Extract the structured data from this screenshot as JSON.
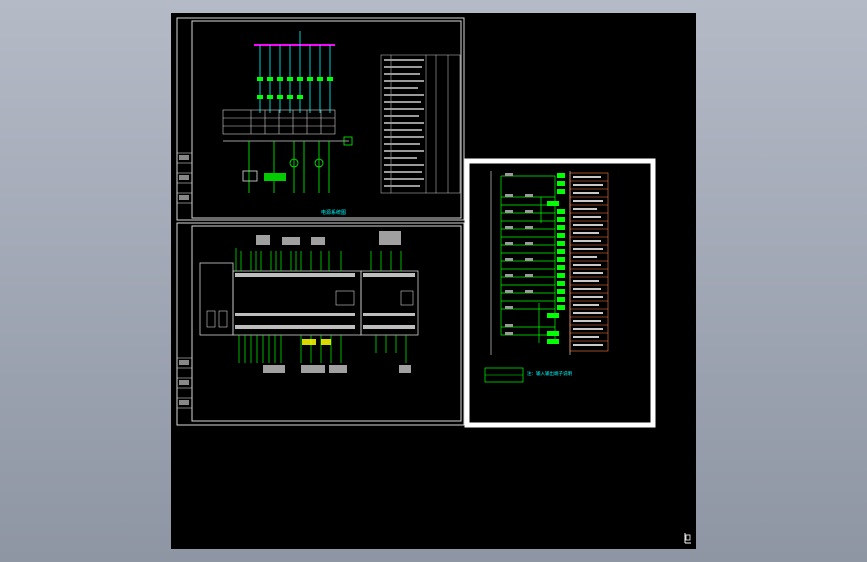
{
  "viewport": {
    "background_top": "#b4bac6",
    "background_bottom": "#8e95a3",
    "canvas_color": "#000000"
  },
  "colors": {
    "frame": "#e8e8e8",
    "wire_green": "#00ff00",
    "bus_magenta": "#ff00ff",
    "cyan": "#00ffff",
    "orange": "#ff8040",
    "yellow": "#ffff00",
    "highlight_frame": "#ffffff"
  },
  "drawing": {
    "sheet1_caption": "电源系统图",
    "plc_note": "注：输入输出端子说明",
    "symbols": {
      "io_prefix_in": "I0.",
      "io_prefix_out": "Q0."
    }
  },
  "icons": {
    "ucs_icon": "ucs-axis-icon"
  }
}
